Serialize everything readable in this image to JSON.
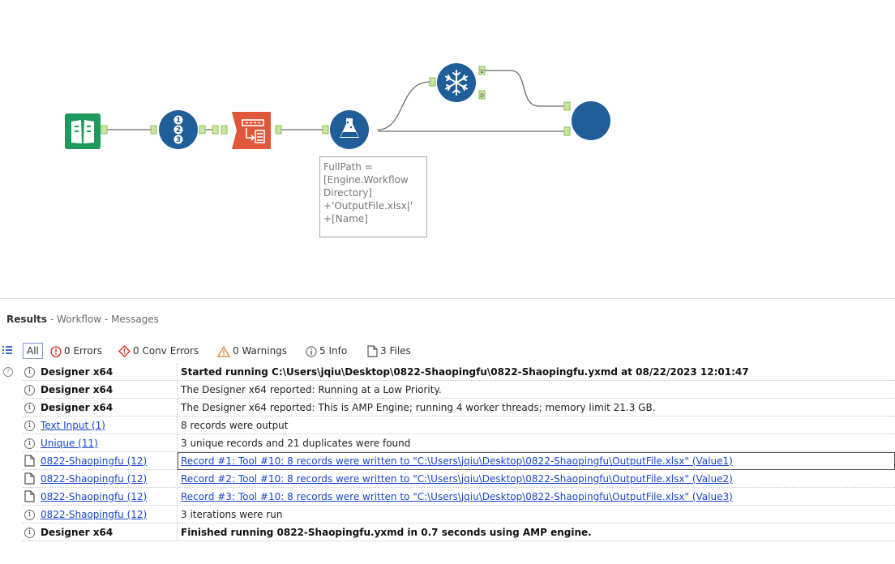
{
  "annotation": {
    "lines": [
      "FullPath =",
      "[Engine.Workflow",
      "Directory]",
      "+'OutputFile.xlsx|'",
      "+[Name]"
    ]
  },
  "tools": [
    {
      "name": "text-input-tool",
      "icon": "book-icon",
      "color": "#1e9a5c"
    },
    {
      "name": "unique-tool",
      "icon": "numbered-list-icon",
      "color": "#1f5e98"
    },
    {
      "name": "record-id-tool",
      "icon": "table-arrow-icon",
      "color": "#e0573a"
    },
    {
      "name": "formula-tool",
      "icon": "flask-icon",
      "color": "#1f5e98"
    },
    {
      "name": "snowflake-tool",
      "icon": "snowflake-icon",
      "color": "#1f5e98"
    },
    {
      "name": "output-tool",
      "icon": "circle-icon",
      "color": "#1f5e98"
    }
  ],
  "anchor_labels": {
    "u": "U",
    "d": "D"
  },
  "results": {
    "title": "Results",
    "breadcrumb": " - Workflow - Messages"
  },
  "filters": {
    "all": "All",
    "errors": "0 Errors",
    "conv_errors": "0 Conv Errors",
    "warnings": "0 Warnings",
    "info": "5 Info",
    "files": "3 Files"
  },
  "messages": [
    {
      "type": "info",
      "source": "Designer x64",
      "link": false,
      "bold": true,
      "text": "Started running C:\\Users\\jqiu\\Desktop\\0822-Shaopingfu\\0822-Shaopingfu.yxmd at 08/22/2023 12:01:47"
    },
    {
      "type": "info",
      "source": "Designer x64",
      "link": false,
      "bold": false,
      "text": "The Designer x64 reported: Running at a Low Priority."
    },
    {
      "type": "info",
      "source": "Designer x64",
      "link": false,
      "bold": false,
      "text": "The Designer x64 reported: This is AMP Engine; running 4 worker threads; memory limit 21.3 GB."
    },
    {
      "type": "info",
      "source": "Text Input (1)",
      "link": true,
      "bold": false,
      "text": "8 records were output"
    },
    {
      "type": "info",
      "source": "Unique (11)",
      "link": true,
      "bold": false,
      "text": "3 unique records and 21 duplicates were found"
    },
    {
      "type": "file",
      "source": "0822-Shaopingfu (12)",
      "link": true,
      "bold": false,
      "text": "Record #1: Tool #10: 8 records were written to \"C:\\Users\\jqiu\\Desktop\\0822-Shaopingfu\\OutputFile.xlsx\" (Value1)"
    },
    {
      "type": "file",
      "source": "0822-Shaopingfu (12)",
      "link": true,
      "bold": false,
      "text": "Record #2: Tool #10: 8 records were written to \"C:\\Users\\jqiu\\Desktop\\0822-Shaopingfu\\OutputFile.xlsx\" (Value2)"
    },
    {
      "type": "file",
      "source": "0822-Shaopingfu (12)",
      "link": true,
      "bold": false,
      "text": "Record #3: Tool #10: 8 records were written to \"C:\\Users\\jqiu\\Desktop\\0822-Shaopingfu\\OutputFile.xlsx\" (Value3)"
    },
    {
      "type": "info",
      "source": "0822-Shaopingfu (12)",
      "link": true,
      "bold": false,
      "text": "3 iterations were run"
    },
    {
      "type": "info",
      "source": "Designer x64",
      "link": false,
      "bold": true,
      "text": "Finished running 0822-Shaopingfu.yxmd in 0.7 seconds using AMP engine."
    }
  ]
}
